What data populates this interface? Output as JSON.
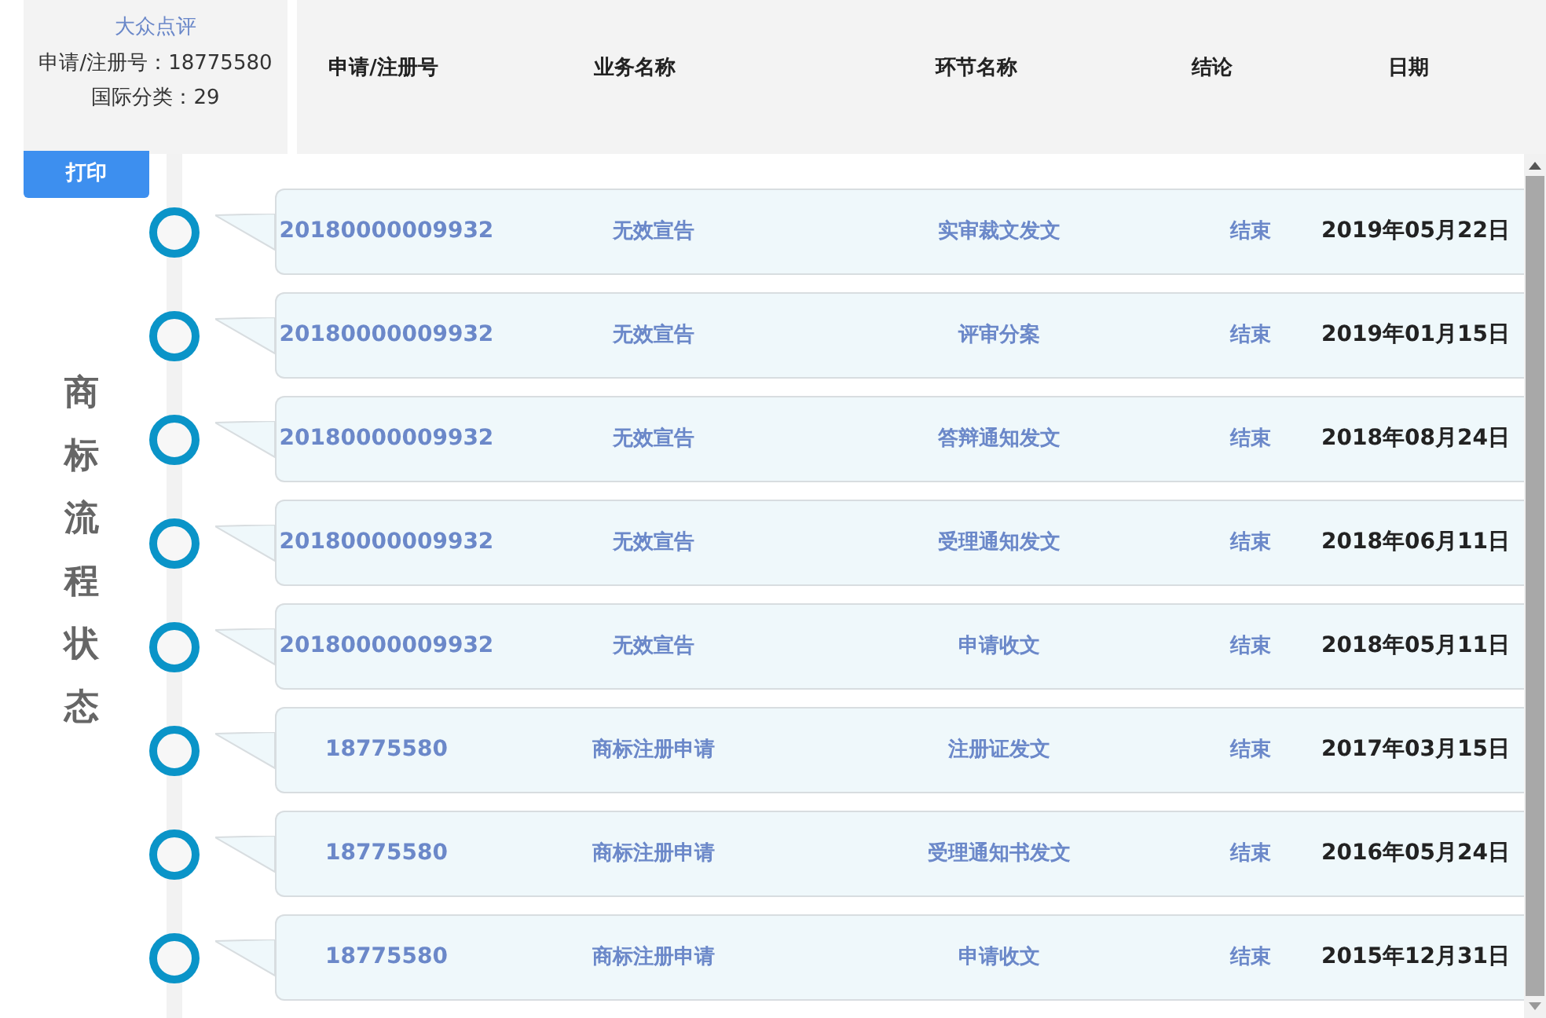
{
  "summary": {
    "brand": "大众点评",
    "reg_no": "申请/注册号：18775580",
    "class": "国际分类：29"
  },
  "columns": [
    "申请/注册号",
    "业务名称",
    "环节名称",
    "结论",
    "日期"
  ],
  "print_button": "打印",
  "side_title": "商标流程状态",
  "rows": [
    {
      "number": "20180000009932",
      "business": "无效宣告",
      "step": "实审裁文发文",
      "result": "结束",
      "date": "2019年05月22日"
    },
    {
      "number": "20180000009932",
      "business": "无效宣告",
      "step": "评审分案",
      "result": "结束",
      "date": "2019年01月15日"
    },
    {
      "number": "20180000009932",
      "business": "无效宣告",
      "step": "答辩通知发文",
      "result": "结束",
      "date": "2018年08月24日"
    },
    {
      "number": "20180000009932",
      "business": "无效宣告",
      "step": "受理通知发文",
      "result": "结束",
      "date": "2018年06月11日"
    },
    {
      "number": "20180000009932",
      "business": "无效宣告",
      "step": "申请收文",
      "result": "结束",
      "date": "2018年05月11日"
    },
    {
      "number": "18775580",
      "business": "商标注册申请",
      "step": "注册证发文",
      "result": "结束",
      "date": "2017年03月15日"
    },
    {
      "number": "18775580",
      "business": "商标注册申请",
      "step": "受理通知书发文",
      "result": "结束",
      "date": "2016年05月24日"
    },
    {
      "number": "18775580",
      "business": "商标注册申请",
      "step": "申请收文",
      "result": "结束",
      "date": "2015年12月31日"
    }
  ]
}
